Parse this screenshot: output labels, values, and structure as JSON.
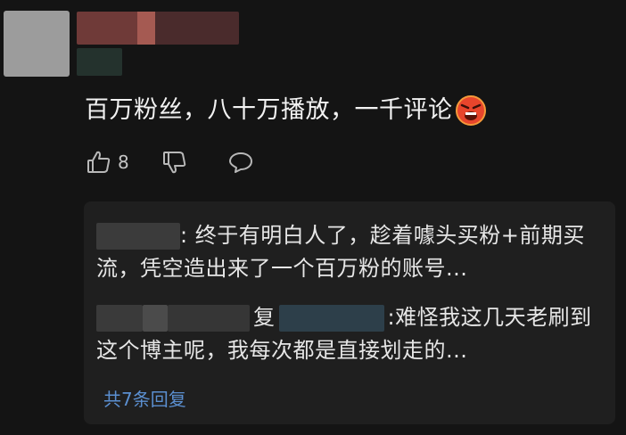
{
  "comment": {
    "text": "百万粉丝，八十万播放，一千评论",
    "emoji": "angry-face-emoji",
    "likes": "8"
  },
  "replies": [
    {
      "separator": ": ",
      "text": "终于有明白人了，趁着噱头买粉+前期买流，凭空造出来了一个百万粉的账号..."
    },
    {
      "reply_word": "复",
      "separator": ":",
      "text": "难怪我这几天老刷到这个博主呢，我每次都是直接划走的..."
    }
  ],
  "more_replies_label": "共7条回复",
  "icons": {
    "like": "thumbs-up-icon",
    "dislike": "thumbs-down-icon",
    "reply": "comment-bubble-icon"
  },
  "colors": {
    "background": "#141414",
    "reply_box": "#1f1f1f",
    "link": "#5b8fd0"
  }
}
